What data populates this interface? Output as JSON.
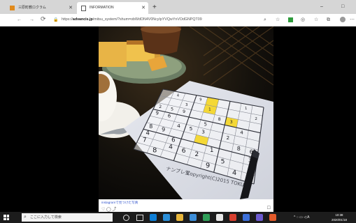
{
  "browser": {
    "tabs": [
      {
        "title": "三原町教ロクラム",
        "active": false
      },
      {
        "title": "INFORMATION",
        "active": true
      }
    ],
    "new_tab_icon": "plus-icon",
    "window_controls": {
      "minimize": "–",
      "maximize": "□"
    },
    "address": {
      "scheme": "https://",
      "host": "advancis.jp",
      "path": "/mitsu_system/?shum=obWdON4V0NcyIpYVQwYnVOdGNPQT09"
    },
    "nav_icons": {
      "back": "←",
      "forward": "→",
      "reload": "⟳",
      "lock": "🔒"
    },
    "toolbar_icons": {
      "zoom": "🔍",
      "favorite": "☆",
      "settings": "⚙",
      "collections": "⧉",
      "favorites_bar": "☆",
      "profile": "person-icon"
    }
  },
  "post": {
    "link_text": "instagramで見つけた写真",
    "actions": "♡ ◯ ⤴",
    "bookmark": "☐",
    "photo_caption": {
      "brand": "ナンプレ堂",
      "copyright": "Copyright(C)2015 TOKU"
    },
    "sudoku_digits": [
      "",
      "4",
      "",
      "9",
      "",
      "",
      "",
      "1",
      "",
      "",
      "",
      "3",
      "",
      "1",
      "",
      "",
      "",
      "2",
      "2",
      "5",
      "9",
      "",
      "",
      "8",
      "3",
      "",
      "",
      "9",
      "6",
      "",
      "",
      "5",
      "",
      "",
      "4",
      "",
      "",
      "",
      "4",
      "5",
      "3",
      "",
      "2",
      "",
      "",
      "8",
      "9",
      "",
      "",
      "",
      "",
      "",
      "8",
      "6",
      "4",
      "",
      "6",
      "",
      "",
      "1",
      "",
      "",
      "3",
      "7",
      "",
      "4",
      "6",
      "2",
      "",
      "5",
      "",
      "",
      "",
      "8",
      "",
      "",
      "",
      "9",
      "",
      "4",
      "6"
    ],
    "highlight_cells": [
      4,
      13,
      24,
      49
    ]
  },
  "taskbar": {
    "search_placeholder": "ここに入力して検索",
    "clock_time": "10:38",
    "clock_date": "2020/01/18",
    "tray_text": "^ ◌ ▭ ◁ A"
  },
  "colors": {
    "accent_yellow": "#f4d836",
    "link_blue": "#3355cc",
    "taskbar": "#1c1c1c"
  }
}
